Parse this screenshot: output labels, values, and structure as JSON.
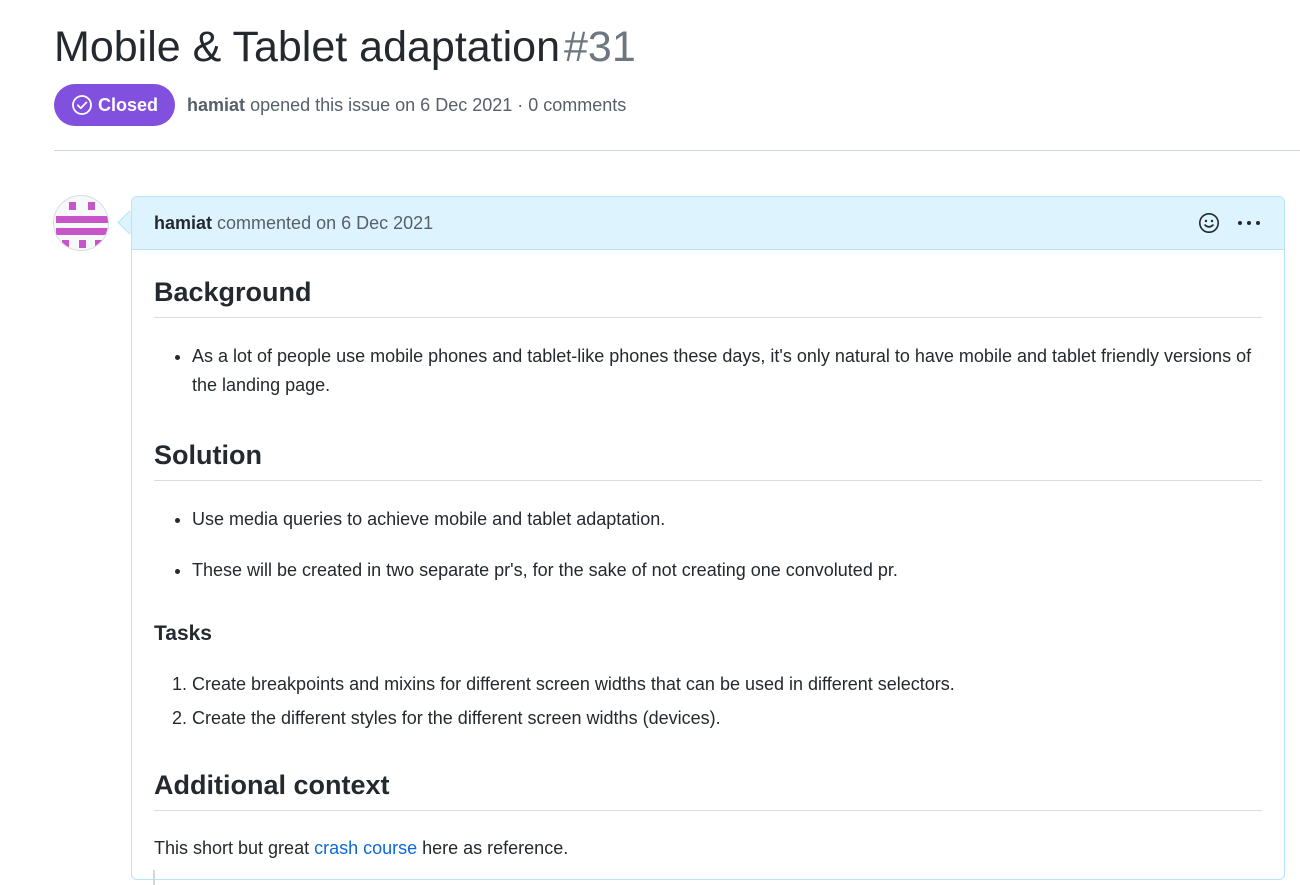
{
  "issue": {
    "title": "Mobile & Tablet adaptation",
    "number": "#31",
    "state": "Closed",
    "state_color": "#8250df",
    "author": "hamiat",
    "meta_text": "opened this issue on 6 Dec 2021 · 0 comments"
  },
  "comment": {
    "author": "hamiat",
    "meta_text": "commented on 6 Dec 2021",
    "reaction_icon": "smiley-icon",
    "more_icon": "kebab-horizontal-icon",
    "body": {
      "background_heading": "Background",
      "background_items": [
        "As a lot of people use mobile phones and tablet-like phones these days, it's only natural to have mobile and tablet friendly versions of the landing page."
      ],
      "solution_heading": "Solution",
      "solution_items": [
        "Use media queries to achieve mobile and tablet adaptation.",
        "These will be created in two separate pr's, for the sake of not creating one convoluted pr."
      ],
      "tasks_heading": "Tasks",
      "tasks_items": [
        "Create breakpoints and mixins for different screen widths that can be used in different selectors.",
        "Create the different styles for the different screen widths (devices)."
      ],
      "context_heading": "Additional context",
      "context_before": "This short but great ",
      "context_link": "crash course",
      "context_after": " here as reference."
    }
  },
  "colors": {
    "accent_link": "#0969da",
    "header_bg": "#ddf4ff",
    "avatar_pattern": "#c755c9"
  }
}
